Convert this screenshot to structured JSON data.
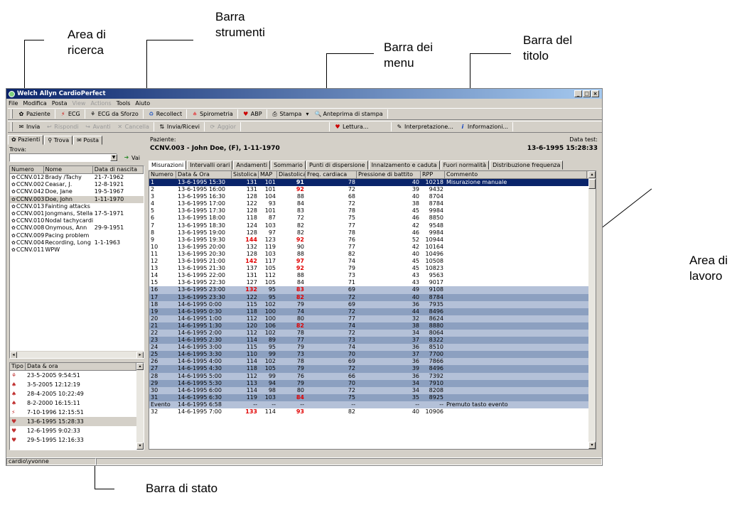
{
  "callouts": {
    "area_ricerca": "Area di\nricerca",
    "barra_strumenti": "Barra\nstrumenti",
    "barra_menu": "Barra dei\nmenu",
    "barra_titolo": "Barra del\ntitolo",
    "area_lavoro": "Area di\nlavoro",
    "barra_stato": "Barra di stato"
  },
  "window": {
    "title": "Welch Allyn CardioPerfect",
    "buttons": [
      "_",
      "□",
      "×"
    ]
  },
  "menu": [
    {
      "label": "File",
      "enabled": true
    },
    {
      "label": "Modifica",
      "enabled": true
    },
    {
      "label": "Posta",
      "enabled": true
    },
    {
      "label": "View",
      "enabled": false
    },
    {
      "label": "Actions",
      "enabled": false
    },
    {
      "label": "Tools",
      "enabled": true
    },
    {
      "label": "Aiuto",
      "enabled": true
    }
  ],
  "toolbar1": {
    "paziente": "Paziente",
    "ecg": "ECG",
    "ecg_sforzo": "ECG da Sforzo",
    "recollect": "Recollect",
    "spirometria": "Spirometria",
    "abp": "ABP",
    "stampa": "Stampa",
    "anteprima": "Anteprima di stampa"
  },
  "toolbar2": {
    "invia": "Invia",
    "rispondi": "Rispondi",
    "avanti": "Avanti",
    "cancella": "Cancella",
    "invia_ricevi": "Invia/Ricevi",
    "aggior": "Aggior",
    "lettura": "Lettura...",
    "interpretazione": "Interpretazione...",
    "informazioni": "Informazioni..."
  },
  "left": {
    "tabs": [
      "Pazienti",
      "Trova",
      "Posta"
    ],
    "trova_label": "Trova:",
    "search_value": "",
    "vai": "Vai",
    "patient_headers": [
      "Numero",
      "Nome",
      "Data di nascita"
    ],
    "patients": [
      {
        "num": "CCNV.012",
        "name": "Brady /Tachy",
        "dob": "21-7-1962"
      },
      {
        "num": "CCNV.002",
        "name": "Ceasar, J.",
        "dob": "12-8-1921"
      },
      {
        "num": "CCNV.042",
        "name": "Doe, Jane",
        "dob": "19-5-1967"
      },
      {
        "num": "CCNV.003",
        "name": "Doe, John",
        "dob": "1-11-1970"
      },
      {
        "num": "CCNV.013",
        "name": "Fainting attacks",
        "dob": ""
      },
      {
        "num": "CCNV.001",
        "name": "Jongmans, Stella",
        "dob": "17-5-1971"
      },
      {
        "num": "CCNV.010",
        "name": "Nodal tachycardia",
        "dob": ""
      },
      {
        "num": "CCNV.008",
        "name": "Onymous, Ann",
        "dob": "29-9-1951"
      },
      {
        "num": "CCNV.009",
        "name": "Pacing problem",
        "dob": ""
      },
      {
        "num": "CCNV.004",
        "name": "Recording, Long",
        "dob": "1-1-1963"
      },
      {
        "num": "CCNV.011",
        "name": "WPW",
        "dob": ""
      }
    ],
    "selected_patient": 3,
    "exam_headers": [
      "Tipo",
      "Data & ora"
    ],
    "exams": [
      {
        "icon": "ecg-sforzo-icon",
        "glyph": "⚘",
        "date": "23-5-2005 9:54:51"
      },
      {
        "icon": "spirometry-icon",
        "glyph": "♠",
        "date": "3-5-2005 12:12:19"
      },
      {
        "icon": "spirometry-icon",
        "glyph": "♠",
        "date": "28-4-2005 10:22:49"
      },
      {
        "icon": "spirometry-icon",
        "glyph": "♠",
        "date": "8-2-2000 16:15:11"
      },
      {
        "icon": "ecg-icon",
        "glyph": "⚡",
        "date": "7-10-1996 12:15:51"
      },
      {
        "icon": "abp-icon",
        "glyph": "♥",
        "date": "13-6-1995 15:28:33"
      },
      {
        "icon": "abp-icon",
        "glyph": "♥",
        "date": "12-6-1995 9:02:33"
      },
      {
        "icon": "abp-icon",
        "glyph": "♥",
        "date": "29-5-1995 12:16:33"
      }
    ],
    "selected_exam": 5
  },
  "right": {
    "paziente_label": "Paziente:",
    "patient_info": "CCNV.003 - John Doe, (F), 1-11-1970",
    "data_test_label": "Data test:",
    "data_test": "13-6-1995 15:28:33",
    "tabs": [
      "Misurazioni",
      "Intervalli orari",
      "Andamenti",
      "Sommario",
      "Punti di dispersione",
      "Innalzamento e caduta",
      "Fuori normalità",
      "Distribuzione frequenza"
    ],
    "active_tab": 0,
    "headers": [
      "Numero",
      "Data & Ora",
      "Sistolica",
      "MAP",
      "Diastolica",
      "Freq. cardiaca",
      "Pressione di battito",
      "RPP",
      "Commento"
    ],
    "rows": [
      [
        "1",
        "13-6-1995 15:30",
        "131",
        "101",
        "91",
        "78",
        "40",
        "10218",
        "Misurazione manuale"
      ],
      [
        "2",
        "13-6-1995 16:00",
        "131",
        "101",
        "92",
        "72",
        "39",
        "9432",
        ""
      ],
      [
        "3",
        "13-6-1995 16:30",
        "128",
        "104",
        "88",
        "68",
        "40",
        "8704",
        ""
      ],
      [
        "4",
        "13-6-1995 17:00",
        "122",
        "93",
        "84",
        "72",
        "38",
        "8784",
        ""
      ],
      [
        "5",
        "13-6-1995 17:30",
        "128",
        "101",
        "83",
        "78",
        "45",
        "9984",
        ""
      ],
      [
        "6",
        "13-6-1995 18:00",
        "118",
        "87",
        "72",
        "75",
        "46",
        "8850",
        ""
      ],
      [
        "7",
        "13-6-1995 18:30",
        "124",
        "103",
        "82",
        "77",
        "42",
        "9548",
        ""
      ],
      [
        "8",
        "13-6-1995 19:00",
        "128",
        "97",
        "82",
        "78",
        "46",
        "9984",
        ""
      ],
      [
        "9",
        "13-6-1995 19:30",
        "144",
        "123",
        "92",
        "76",
        "52",
        "10944",
        ""
      ],
      [
        "10",
        "13-6-1995 20:00",
        "132",
        "119",
        "90",
        "77",
        "42",
        "10164",
        ""
      ],
      [
        "11",
        "13-6-1995 20:30",
        "128",
        "103",
        "88",
        "82",
        "40",
        "10496",
        ""
      ],
      [
        "12",
        "13-6-1995 21:00",
        "142",
        "117",
        "97",
        "74",
        "45",
        "10508",
        ""
      ],
      [
        "13",
        "13-6-1995 21:30",
        "137",
        "105",
        "92",
        "79",
        "45",
        "10823",
        ""
      ],
      [
        "14",
        "13-6-1995 22:00",
        "131",
        "112",
        "88",
        "73",
        "43",
        "9563",
        ""
      ],
      [
        "15",
        "13-6-1995 22:30",
        "127",
        "105",
        "84",
        "71",
        "43",
        "9017",
        ""
      ],
      [
        "16",
        "13-6-1995 23:00",
        "132",
        "95",
        "83",
        "69",
        "49",
        "9108",
        ""
      ],
      [
        "17",
        "13-6-1995 23:30",
        "122",
        "95",
        "82",
        "72",
        "40",
        "8784",
        ""
      ],
      [
        "18",
        "14-6-1995 0:00",
        "115",
        "102",
        "79",
        "69",
        "36",
        "7935",
        ""
      ],
      [
        "19",
        "14-6-1995 0:30",
        "118",
        "100",
        "74",
        "72",
        "44",
        "8496",
        ""
      ],
      [
        "20",
        "14-6-1995 1:00",
        "112",
        "100",
        "80",
        "77",
        "32",
        "8624",
        ""
      ],
      [
        "21",
        "14-6-1995 1:30",
        "120",
        "106",
        "82",
        "74",
        "38",
        "8880",
        ""
      ],
      [
        "22",
        "14-6-1995 2:00",
        "112",
        "102",
        "78",
        "72",
        "34",
        "8064",
        ""
      ],
      [
        "23",
        "14-6-1995 2:30",
        "114",
        "89",
        "77",
        "73",
        "37",
        "8322",
        ""
      ],
      [
        "24",
        "14-6-1995 3:00",
        "115",
        "95",
        "79",
        "74",
        "36",
        "8510",
        ""
      ],
      [
        "25",
        "14-6-1995 3:30",
        "110",
        "99",
        "73",
        "70",
        "37",
        "7700",
        ""
      ],
      [
        "26",
        "14-6-1995 4:00",
        "114",
        "102",
        "78",
        "69",
        "36",
        "7866",
        ""
      ],
      [
        "27",
        "14-6-1995 4:30",
        "118",
        "105",
        "79",
        "72",
        "39",
        "8496",
        ""
      ],
      [
        "28",
        "14-6-1995 5:00",
        "112",
        "99",
        "76",
        "66",
        "36",
        "7392",
        ""
      ],
      [
        "29",
        "14-6-1995 5:30",
        "113",
        "94",
        "79",
        "70",
        "34",
        "7910",
        ""
      ],
      [
        "30",
        "14-6-1995 6:00",
        "114",
        "98",
        "80",
        "72",
        "34",
        "8208",
        ""
      ],
      [
        "31",
        "14-6-1995 6:30",
        "119",
        "103",
        "84",
        "75",
        "35",
        "8925",
        ""
      ],
      [
        "Evento",
        "14-6-1995 6:58",
        "--",
        "--",
        "--",
        "--",
        "--",
        "--",
        "Premuto tasto evento"
      ],
      [
        "32",
        "14-6-1995 7:00",
        "133",
        "114",
        "93",
        "82",
        "40",
        "10906",
        ""
      ]
    ],
    "red_cells": [
      [
        0,
        4
      ],
      [
        1,
        4
      ],
      [
        8,
        2
      ],
      [
        8,
        4
      ],
      [
        11,
        2
      ],
      [
        11,
        4
      ],
      [
        12,
        4
      ],
      [
        15,
        2
      ],
      [
        15,
        4
      ],
      [
        16,
        4
      ],
      [
        20,
        4
      ],
      [
        30,
        4
      ],
      [
        32,
        2
      ],
      [
        32,
        4
      ]
    ],
    "selected_row": 0,
    "night_rows_from": 15,
    "night_rows_to": 31
  },
  "status": {
    "user": "cardio\\yvonne"
  }
}
